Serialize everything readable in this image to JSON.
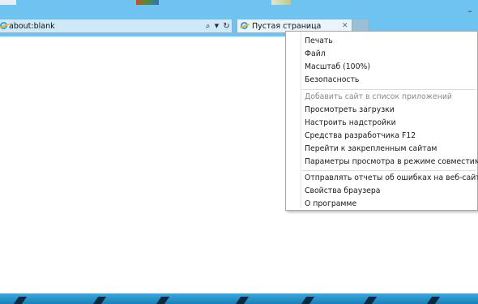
{
  "browser": {
    "address": "about:blank",
    "tab_title": "Пустая страница",
    "minimize_glyph": "–"
  },
  "tools_menu": {
    "group1": [
      "Печать",
      "Файл",
      "Масштаб (100%)",
      "Безопасность"
    ],
    "group2": [
      "Добавить сайт в список приложений",
      "Просмотреть загрузки",
      "Настроить надстройки",
      "Средства разработчика F12",
      "Перейти к закрепленным сайтам",
      "Параметры просмотра в режиме совместимости"
    ],
    "group3": [
      "Отправлять отчеты об ошибках на веб-сайтах",
      "Свойства браузера",
      "О программе"
    ]
  },
  "colors": {
    "chrome": "#6fc3f0",
    "taskbar": "#1b7fb8",
    "ie_blue": "#2f9de0",
    "ie_gold": "#f1b72a"
  },
  "icons": [
    "ie-icon",
    "search-icon",
    "dropdown-icon",
    "refresh-icon",
    "close-icon",
    "minimize-icon"
  ]
}
